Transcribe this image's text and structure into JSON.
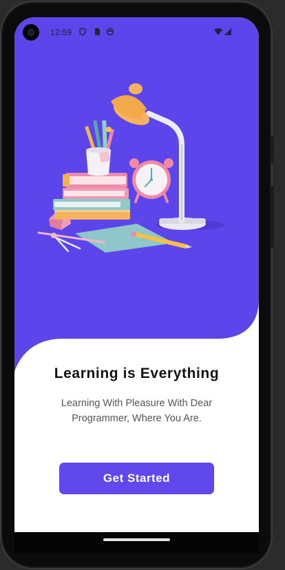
{
  "status_bar": {
    "time": "12:59"
  },
  "onboarding": {
    "title": "Learning is Everything",
    "subtitle": "Learning With Pleasure With Dear Programmer, Where You Are.",
    "cta_label": "Get Started"
  },
  "colors": {
    "accent": "#6048ec",
    "hero_background": "#5c45ea",
    "title_text": "#121212",
    "subtitle_text": "#555555",
    "screen_background": "#ffffff"
  }
}
